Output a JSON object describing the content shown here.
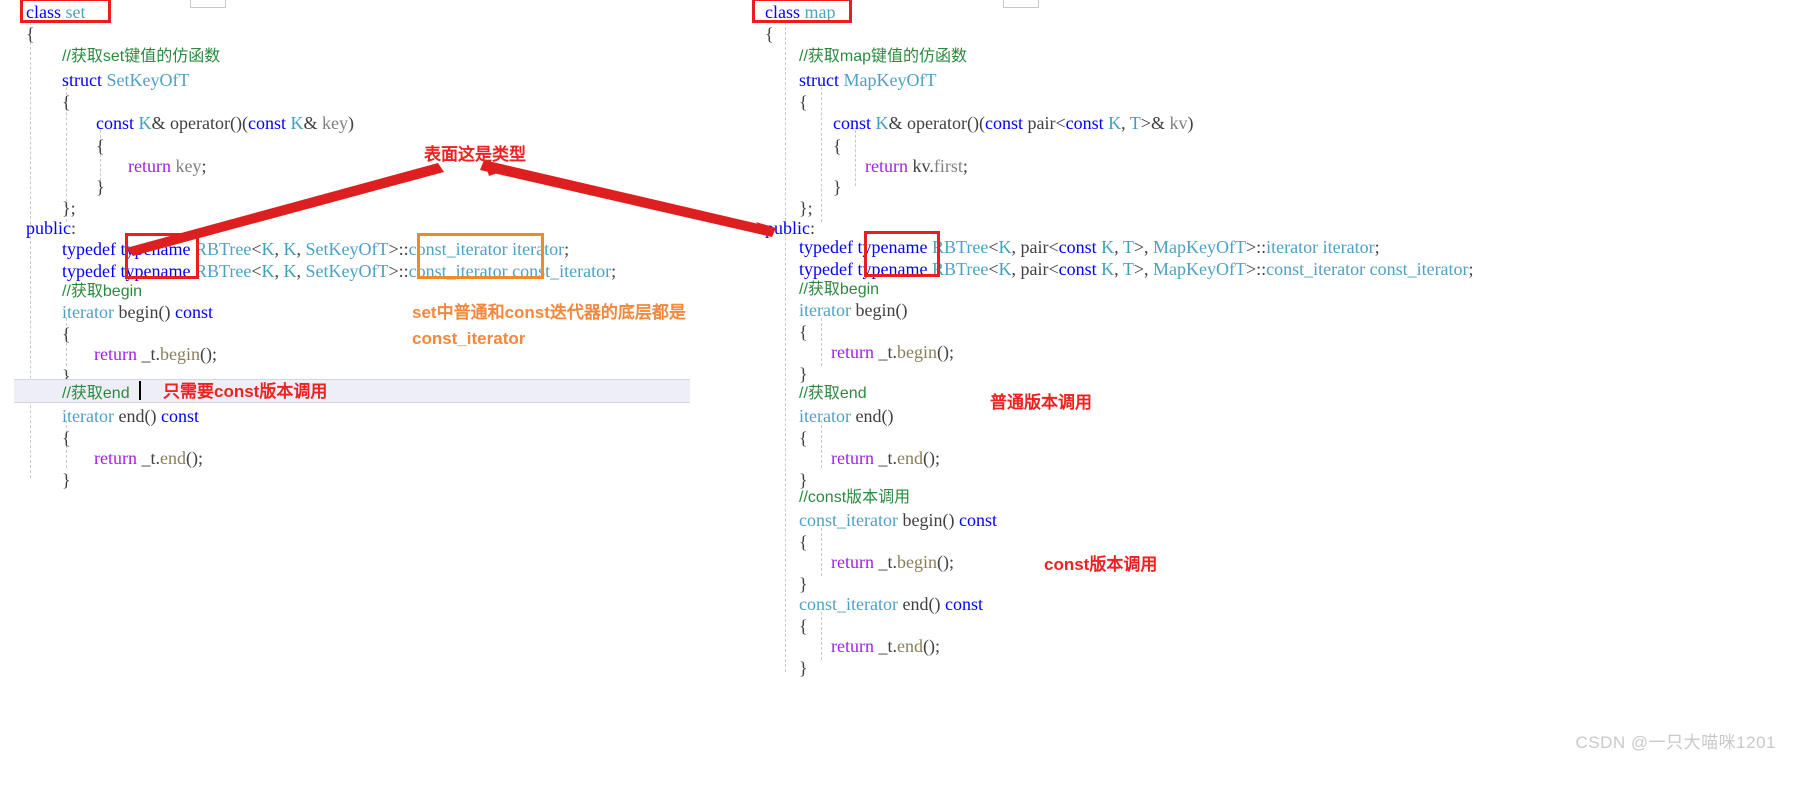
{
  "document": {
    "kind": "code-comparison-screenshot",
    "watermark": "CSDN @一只大喵咪1201"
  },
  "panes": {
    "set": {
      "title": "class set",
      "lines": [
        "class set",
        "{",
        "    //获取set键值的仿函数",
        "    struct SetKeyOfT",
        "    {",
        "        const K& operator()(const K& key)",
        "        {",
        "            return key;",
        "        }",
        "    };",
        "public:",
        "    typedef typename RBTree<K, K, SetKeyOfT>::const_iterator iterator;",
        "    typedef typename RBTree<K, K, SetKeyOfT>::const_iterator const_iterator;",
        "    //获取begin",
        "    iterator begin() const",
        "    {",
        "        return _t.begin();",
        "    }",
        "    //获取end",
        "    iterator end() const",
        "    {",
        "        return _t.end();",
        "    }"
      ]
    },
    "map": {
      "title": "class map",
      "lines": [
        "class map",
        "{",
        "    //获取map键值的仿函数",
        "    struct MapKeyOfT",
        "    {",
        "        const K& operator()(const pair<const K, T>& kv)",
        "        {",
        "            return kv.first;",
        "        }",
        "    };",
        "public:",
        "    typedef typename RBTree<K, pair<const K, T>, MapKeyOfT>::iterator iterator;",
        "    typedef typename RBTree<K, pair<const K, T>, MapKeyOfT>::const_iterator const_iterator;",
        "    //获取begin",
        "    iterator begin()",
        "    {",
        "        return _t.begin();",
        "    }",
        "    //获取end",
        "    iterator end()",
        "    {",
        "        return _t.end();",
        "    }",
        "    //const版本调用",
        "    const_iterator begin() const",
        "    {",
        "        return _t.begin();",
        "    }",
        "    const_iterator end() const",
        "    {",
        "        return _t.end();",
        "    }"
      ]
    }
  },
  "annotations": [
    {
      "id": "a1",
      "text": "表面这是类型",
      "color": "#ee2222",
      "style": "red"
    },
    {
      "id": "a2",
      "text": "set中普通和const迭代器的底层都是",
      "color": "#f4883c",
      "style": "orange"
    },
    {
      "id": "a3",
      "text": "const_iterator",
      "color": "#f4883c",
      "style": "orange"
    },
    {
      "id": "a4",
      "text": "只需要const版本调用",
      "color": "#ee2222",
      "style": "red"
    },
    {
      "id": "a5",
      "text": "普通版本调用",
      "color": "#ee2222",
      "style": "red"
    },
    {
      "id": "a6",
      "text": "const版本调用",
      "color": "#ee2222",
      "style": "red"
    }
  ],
  "highlights": {
    "red_boxes": [
      "class set",
      "class map",
      "typename (set, both typedefs)",
      "typename (map, both typedefs)"
    ],
    "orange_boxes": [
      "const_iterator (set iterator typedef)",
      "const_iterator (set const_iterator typedef)"
    ]
  },
  "colors": {
    "keyword": "#2727ff",
    "type": "#4ea1c4",
    "comment": "#2a8a3e",
    "return_keyword": "#a020f0",
    "identifier": "#808080",
    "annotation_red": "#ee2222",
    "annotation_orange": "#f4883c",
    "box_red": "#ee1c1c",
    "box_orange": "#f08a26",
    "watermark": "#c9c9c9",
    "background": "#ffffff"
  }
}
